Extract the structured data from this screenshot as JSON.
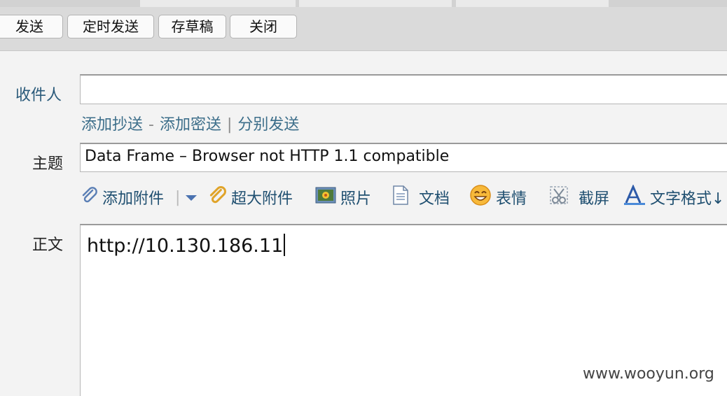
{
  "toolbar": {
    "send": "发送",
    "scheduled_send": "定时发送",
    "save_draft": "存草稿",
    "close": "关闭"
  },
  "form": {
    "recipient_label": "收件人",
    "recipient_value": "",
    "add_cc": "添加抄送",
    "add_bcc": "添加密送",
    "separate_send": "分别发送",
    "dash": "-",
    "pipe": "|",
    "subject_label": "主题",
    "subject_value": "Data Frame – Browser not HTTP 1.1 compatible",
    "body_label": "正文",
    "body_value": "http://10.130.186.11"
  },
  "attachments": {
    "add_attachment": "添加附件",
    "large_attachment": "超大附件",
    "photo": "照片",
    "document": "文档",
    "emoji": "表情",
    "screenshot": "截屏",
    "text_format": "文字格式↓"
  },
  "icons": {
    "paperclip": "paperclip-icon",
    "large_paperclip": "large-paperclip-icon",
    "photo": "photo-icon",
    "document": "document-icon",
    "emoji": "emoji-icon",
    "scissors": "scissors-icon",
    "text_format": "text-format-icon"
  },
  "watermark": "www.wooyun.org"
}
